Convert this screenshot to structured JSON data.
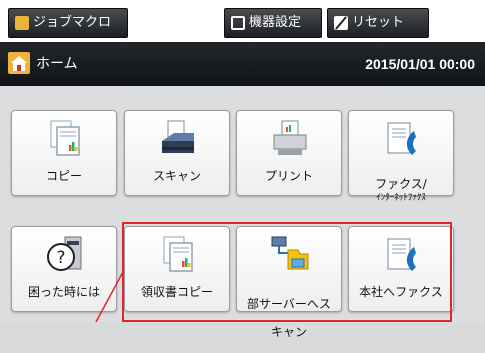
{
  "toolbar": {
    "job_macro_label": "ジョブマクロ",
    "device_settings_label": "機器設定",
    "reset_label": "リセット"
  },
  "header": {
    "home_label": "ホーム",
    "datetime": "2015/01/01 00:00"
  },
  "tiles": {
    "copy": "コピー",
    "scan": "スキャン",
    "print": "プリント",
    "fax_main": "ファクス/",
    "fax_sub": "ｲﾝﾀｰﾈｯﾄﾌｧｸｽ",
    "help": "困った時には",
    "receipt_copy": "領収書コピー",
    "dept_scan_line1": "部サーバーへス",
    "dept_scan_line2": "キャン",
    "hq_fax": "本社へファクス"
  },
  "colors": {
    "highlight": "#e0262d",
    "header_bg": "#1a1d21",
    "tile_bg": "#f5f5f6"
  }
}
